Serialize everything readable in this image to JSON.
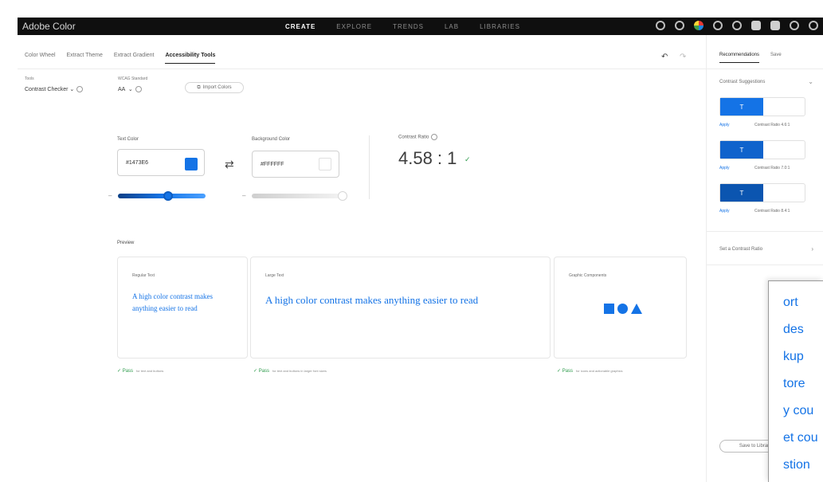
{
  "app": {
    "title": "Adobe Color",
    "nav": [
      "CREATE",
      "EXPLORE",
      "TRENDS",
      "LAB",
      "LIBRARIES"
    ],
    "nav_active": "CREATE"
  },
  "subtabs": [
    "Color Wheel",
    "Extract Theme",
    "Extract Gradient",
    "Accessibility Tools"
  ],
  "subtab_active": "Accessibility Tools",
  "tools": {
    "tool_label": "Tools",
    "tool_value": "Contrast Checker",
    "wcag_label": "WCAG Standard",
    "wcag_value": "AA",
    "import_label": "Import Colors"
  },
  "picker": {
    "text_label": "Text Color",
    "text_hex": "#1473E6",
    "text_color": "#1473e6",
    "bg_label": "Background Color",
    "bg_hex": "#FFFFFF",
    "bg_color": "#ffffff",
    "ratio_label": "Contrast Ratio",
    "ratio_value": "4.58 : 1"
  },
  "preview": {
    "title": "Preview",
    "regular_label": "Regular Text",
    "regular_text": "A high color contrast makes anything easier to read",
    "large_label": "Large Text",
    "large_text": "A high color contrast makes anything easier to read",
    "graphic_label": "Graphic Components",
    "pass_label": "Pass",
    "pass_regular": "for text and buttons",
    "pass_large": "for text and buttons in larger font sizes",
    "pass_graphic": "for icons and actionable graphics"
  },
  "right_panel": {
    "tab_recommendations": "Recommendations",
    "tab_save": "Save",
    "contrast_suggestions": "Contrast Suggestions",
    "suggestions": [
      {
        "color": "#1473e6",
        "apply": "Apply",
        "ratio": "Contrast Ratio 4.6:1"
      },
      {
        "color": "#0f63cc",
        "apply": "Apply",
        "ratio": "Contrast Ratio 7.0:1"
      },
      {
        "color": "#0b55b0",
        "apply": "Apply",
        "ratio": "Contrast Ratio 8.4:1"
      }
    ],
    "swatch_letter": "T",
    "set_contrast_ratio": "Set a Contrast Ratio",
    "save_button": "Save to Library"
  },
  "overlay_items": [
    "ort",
    "des",
    "kup",
    "tore",
    "y cou",
    "et cou",
    "stion"
  ]
}
